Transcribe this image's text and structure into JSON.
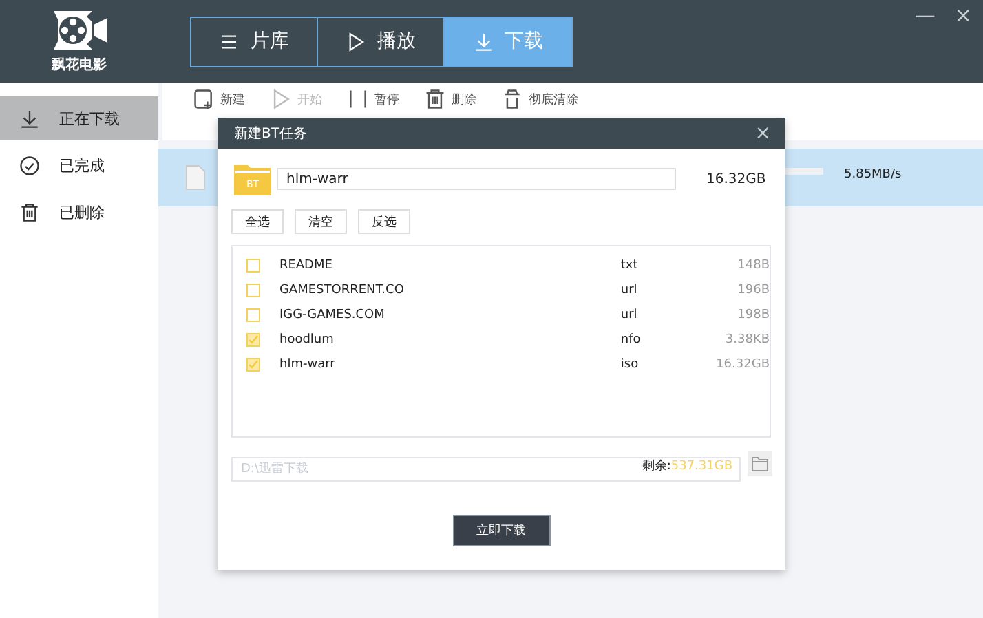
{
  "app": {
    "logo_text": "飘花电影"
  },
  "tabs": [
    {
      "label": "片库",
      "selected": false
    },
    {
      "label": "播放",
      "selected": false
    },
    {
      "label": "下载",
      "selected": true
    }
  ],
  "window_controls": [
    "—",
    "×"
  ],
  "sidebar": {
    "items": [
      {
        "label": "正在下载",
        "selected": true
      },
      {
        "label": "已完成",
        "selected": false
      },
      {
        "label": "已删除",
        "selected": false
      }
    ]
  },
  "toolbar": [
    {
      "label": "新建",
      "disabled": false
    },
    {
      "label": "开始",
      "disabled": true
    },
    {
      "label": "暂停",
      "disabled": false
    },
    {
      "label": "删除",
      "disabled": false
    },
    {
      "label": "彻底清除",
      "disabled": false
    }
  ],
  "download": {
    "speed": "5.85MB/s",
    "selected": true
  },
  "dialog": {
    "title": "新建BT任务",
    "close": "×",
    "torrent_badge": "BT",
    "name": "hlm-warr",
    "total_size": "16.32GB",
    "buttons": [
      "全选",
      "清空",
      "反选"
    ],
    "files": [
      {
        "name": "README",
        "type": "txt",
        "size": "148B",
        "checked": false
      },
      {
        "name": "GAMESTORRENT.CO",
        "type": "url",
        "size": "196B",
        "checked": false
      },
      {
        "name": "IGG-GAMES.COM",
        "type": "url",
        "size": "198B",
        "checked": false
      },
      {
        "name": "hoodlum",
        "type": "nfo",
        "size": "3.38KB",
        "checked": true
      },
      {
        "name": "hlm-warr",
        "type": "iso",
        "size": "16.32GB",
        "checked": true
      }
    ],
    "path_placeholder": "D:\\迅雷下载",
    "free_label": "剩余:",
    "free_space": "537.31GB",
    "submit": "立即下载"
  }
}
